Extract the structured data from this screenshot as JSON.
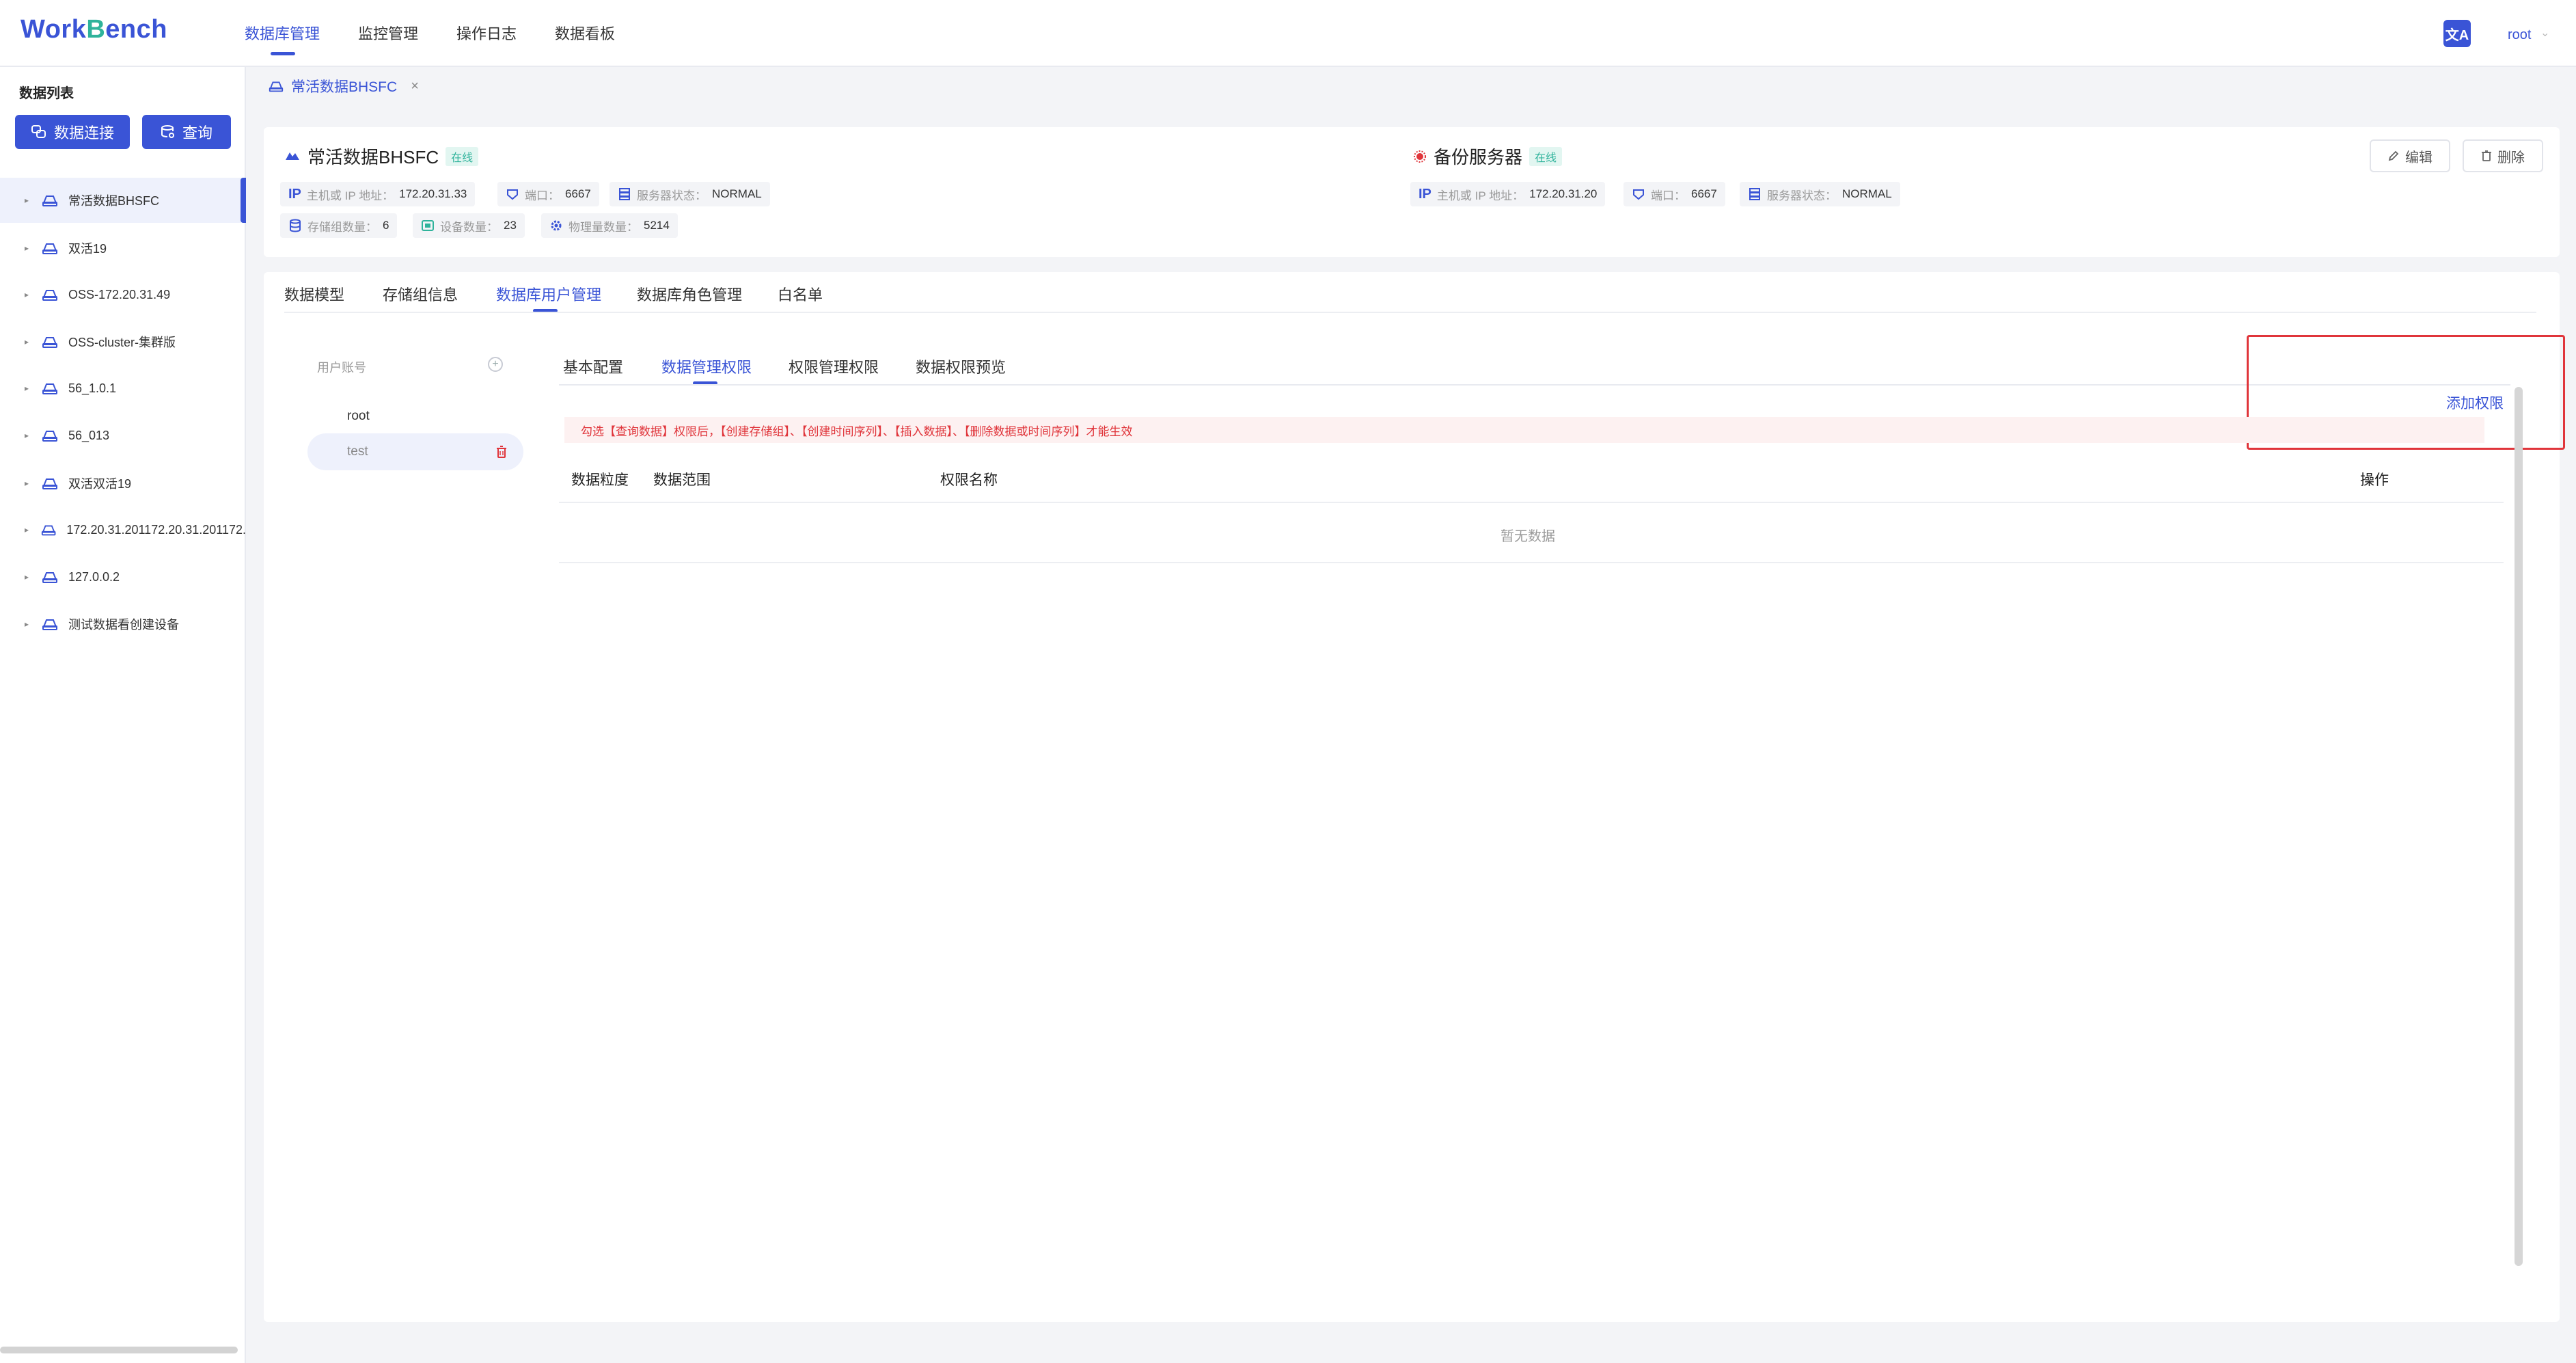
{
  "app": {
    "logo_w": "W",
    "logo_ork": "ork",
    "logo_b": "B",
    "logo_ench": "ench"
  },
  "nav": {
    "items": [
      {
        "label": "数据库管理",
        "active": true
      },
      {
        "label": "监控管理",
        "active": false
      },
      {
        "label": "操作日志",
        "active": false
      },
      {
        "label": "数据看板",
        "active": false
      }
    ],
    "lang_icon": "translate-icon",
    "lang_glyph": "文A",
    "user": "root"
  },
  "sidebar": {
    "title": "数据列表",
    "connect_btn": "数据连接",
    "query_btn": "查询",
    "items": [
      {
        "label": "常活数据BHSFC",
        "selected": true
      },
      {
        "label": "双活19"
      },
      {
        "label": "OSS-172.20.31.49"
      },
      {
        "label": "OSS-cluster-集群版"
      },
      {
        "label": "56_1.0.1"
      },
      {
        "label": "56_013"
      },
      {
        "label": "双活双活19"
      },
      {
        "label": "172.20.31.201172.20.31.201172."
      },
      {
        "label": "127.0.0.2"
      },
      {
        "label": "测试数据看创建设备"
      }
    ]
  },
  "breadcrumb": {
    "label": "常活数据BHSFC",
    "close": "×"
  },
  "info": {
    "primary": {
      "name": "常活数据BHSFC",
      "status": "在线",
      "ip_icon": "IP",
      "ip_label": "主机或 IP 地址：",
      "ip_value": "172.20.31.33",
      "port_label": "端口：",
      "port_value": "6667",
      "srv_label": "服务器状态：",
      "srv_value": "NORMAL",
      "sg_label": "存储组数量：",
      "sg_value": "6",
      "dev_label": "设备数量：",
      "dev_value": "23",
      "phy_label": "物理量数量：",
      "phy_value": "5214"
    },
    "backup": {
      "name": "备份服务器",
      "status": "在线",
      "ip_icon": "IP",
      "ip_label": "主机或 IP 地址：",
      "ip_value": "172.20.31.20",
      "port_label": "端口：",
      "port_value": "6667",
      "srv_label": "服务器状态：",
      "srv_value": "NORMAL"
    },
    "edit_btn": "编辑",
    "delete_btn": "删除"
  },
  "main_tabs": [
    {
      "label": "数据模型"
    },
    {
      "label": "存储组信息"
    },
    {
      "label": "数据库用户管理",
      "active": true
    },
    {
      "label": "数据库角色管理"
    },
    {
      "label": "白名单"
    }
  ],
  "users": {
    "label": "用户账号",
    "plus": "+",
    "items": [
      {
        "name": "root"
      },
      {
        "name": "test",
        "selected": true
      }
    ]
  },
  "sub_tabs": [
    {
      "label": "基本配置"
    },
    {
      "label": "数据管理权限",
      "active": true
    },
    {
      "label": "权限管理权限"
    },
    {
      "label": "数据权限预览"
    }
  ],
  "permissions": {
    "add_label": "添加权限",
    "notice": "勾选【查询数据】权限后，【创建存储组】、【创建时间序列】、【插入数据】、【删除数据或时间序列】才能生效",
    "columns": [
      "数据粒度",
      "数据范围",
      "权限名称",
      "操作"
    ],
    "empty": "暂无数据"
  },
  "colors": {
    "accent": "#3a54d6",
    "success": "#2fb39b",
    "danger": "#e0353b"
  }
}
